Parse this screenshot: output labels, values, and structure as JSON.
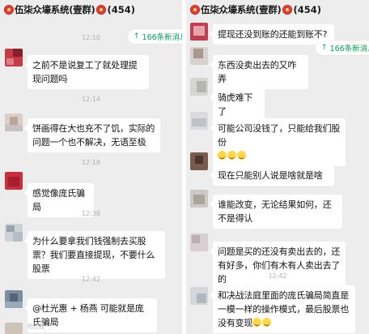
{
  "header": {
    "title": "伍柒众壕系统(壹群)",
    "count": "(454)"
  },
  "new_messages": "166条新消息",
  "left": {
    "timestamps": [
      "12:10",
      "12:14",
      "12:18",
      "12:38",
      "12:42"
    ],
    "messages": [
      "之前不是说复工了就处理提现问题吗",
      "饼画得在大也充不了饥，实际的问题一个也不解决，无语至极",
      "感觉像庞氏骗局",
      "为什么要拿我们钱强制去买股票？我们要直接提现，不要什么股票",
      "@杜光惠 + 杨燕  可能就是庞氏骗局"
    ],
    "sender_name_bottom": "杨正斌"
  },
  "right": {
    "timestamps": [
      "12:42"
    ],
    "messages": [
      "提现还没到账的还能到账不?",
      "东西没卖出去的又咋弄",
      "骑虎难下了",
      "可能公司没钱了，只能给我们股份",
      "现在只能别人说是啥就是啥",
      "谁能改变，无论结果如何，还不是得认",
      "问题是买的还没有卖出去的，还有好多，你们有木有人卖出去了的",
      "和决战法庭里面的庞氏骗局简直是一模一样的操作模式，最后股票也没有变现"
    ]
  },
  "colors": {
    "background": "#ededed",
    "bubble": "#ffffff",
    "accent_green": "#07a05a",
    "timestamp": "#b2b2b2"
  },
  "icons": [
    "flower-emoji-icon",
    "up-arrow-icon",
    "avatar-image",
    "smiley-emoji-icon"
  ]
}
